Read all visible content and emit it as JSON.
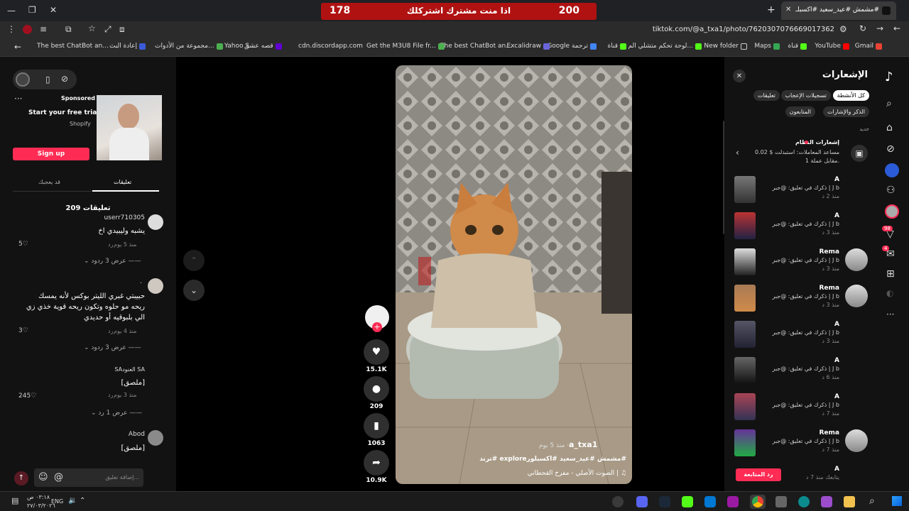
{
  "browser": {
    "tab_title": "#مشمش #عيد_سعيد #اكسبلـ...",
    "url": "tiktok.com/@a_txa1/photo/7620307076669017362",
    "bookmarks": [
      "Gmail",
      "YouTube",
      "قناة",
      "Maps",
      "New folder",
      "لوحة تحكم متشلي الم...",
      "قناة",
      "Google ترجمة",
      "Excalidraw",
      "The best ChatBot an...",
      "Get the M3U8 File fr...",
      "cdn.discordapp.com",
      "قصه عشق",
      "Yahoo S...",
      "مجموعة من الأدوات...",
      "إعادة البث",
      "The best ChatBot an..."
    ]
  },
  "banner": {
    "left_num": "178",
    "text": "اذا منت مشترك اشتركلك",
    "right_num": "200"
  },
  "ad": {
    "label": "Sponsored",
    "title": "Start your free trial",
    "brand": "Shopify",
    "cta": "Sign up"
  },
  "comments_panel": {
    "tabs": [
      "تعليقات",
      "قد يعجبك"
    ],
    "count_label": "209 تعليقات",
    "items": [
      {
        "user": "userr710305",
        "text": "يشبه وليبيدي اخ",
        "meta": "منذ 5 يوم",
        "reply": "رد",
        "likes": "5",
        "more": "عرض 3 ردود"
      },
      {
        "user": ".",
        "text": "حبيبتي غبري الليتر بوكس لأنه يمسك ريحه مو حلوه وتكون ريحه قوية خذي زي الي بلبوقيه أو حديدي",
        "meta": "منذ 4 يوم",
        "reply": "رد",
        "likes": "3",
        "more": "عرض 3 ردود"
      },
      {
        "user": "SAالعنود SA",
        "text": "[ملصق]",
        "meta": "منذ 3 يوم",
        "reply": "رد",
        "likes": "245",
        "more": "عرض 1 رد"
      },
      {
        "user": "Abod",
        "text": "[ملصق]",
        "meta": "",
        "reply": "",
        "likes": "",
        "more": ""
      }
    ],
    "input_placeholder": "إضافة تعليق..."
  },
  "video": {
    "author": "a_txa1",
    "time": "منذ 5 يوم",
    "caption": "#مشمش #عيد_سعيد #اكسبلورexplore #ترند",
    "sound": "الصوت الأصلي - مفرح القحطاني",
    "likes": "15.1K",
    "comments": "209",
    "saves": "1063",
    "shares": "10.9K"
  },
  "notifications": {
    "title": "الإشعارات",
    "filters_row1": [
      "كل الأنشطة",
      "تسجيلات الإعجاب",
      "تعليقات"
    ],
    "filters_row2": [
      "الذكر والإشارات",
      "المتابعون"
    ],
    "section": "جديد",
    "system": {
      "title": "إشعارات النظام",
      "line1": "مساعد المعاملات: استبدلت $ 0.02",
      "line2": "مقابل عملة 1."
    },
    "items": [
      {
        "name": "A",
        "text": "ذكرك في تعليق: @جبر | J b",
        "time": "منذ 2 د"
      },
      {
        "name": "A",
        "text": "ذكرك في تعليق: @جبر | J b",
        "time": "منذ 3 د"
      },
      {
        "name": "Rema",
        "text": "ذكرك في تعليق: @جبر | J b",
        "time": "منذ 3 د"
      },
      {
        "name": "Rema",
        "text": "ذكرك في تعليق: @جبر | J b",
        "time": "منذ 3 د"
      },
      {
        "name": "A",
        "text": "ذكرك في تعليق: @جبر | J b",
        "time": "منذ 3 د"
      },
      {
        "name": "A",
        "text": "ذكرك في تعليق: @جبر | J b",
        "time": "منذ 6 د"
      },
      {
        "name": "A",
        "text": "ذكرك في تعليق: @جبر | J b",
        "time": "منذ 7 د"
      },
      {
        "name": "Rema",
        "text": "ذكرك في تعليق: @جبر | J b",
        "time": "منذ 7 د"
      }
    ],
    "last": {
      "name": "A",
      "text": "يتابعك منذ 7 د",
      "button": "رد المتابعة"
    }
  },
  "rightnav": {
    "badge1": "98",
    "badge2": "4"
  },
  "taskbar": {
    "lang": "ENG",
    "time": "٠٣:١٨ ص",
    "date": "٢٧/٠٣/٢٠٢٦"
  },
  "colors": {
    "accent": "#fe2c55",
    "banner": "#b01212"
  }
}
